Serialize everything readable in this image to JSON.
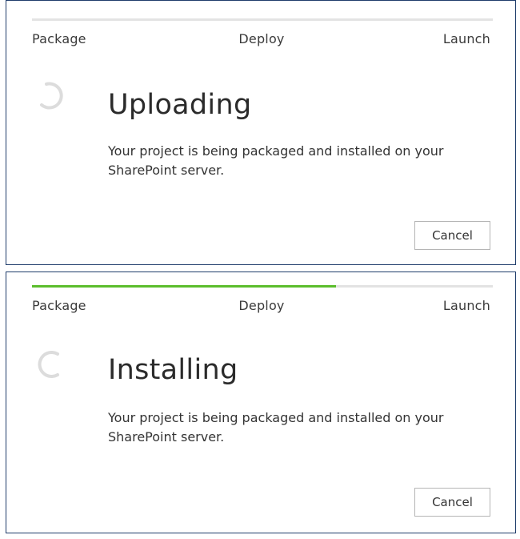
{
  "colors": {
    "progress_track": "#e3e3e3",
    "progress_fill": "#5bbd2c",
    "panel_border": "#1f3d6b",
    "spinner": "#dcdcdc"
  },
  "panels": [
    {
      "steps": {
        "package": "Package",
        "deploy": "Deploy",
        "launch": "Launch"
      },
      "progress_percent": 0,
      "spinner_icon": "loading-spinner-icon",
      "title": "Uploading",
      "description": "Your project is being packaged and installed on your SharePoint server.",
      "cancel_label": "Cancel"
    },
    {
      "steps": {
        "package": "Package",
        "deploy": "Deploy",
        "launch": "Launch"
      },
      "progress_percent": 66,
      "spinner_icon": "loading-spinner-icon",
      "title": "Installing",
      "description": "Your project is being packaged and installed on your SharePoint server.",
      "cancel_label": "Cancel"
    }
  ]
}
